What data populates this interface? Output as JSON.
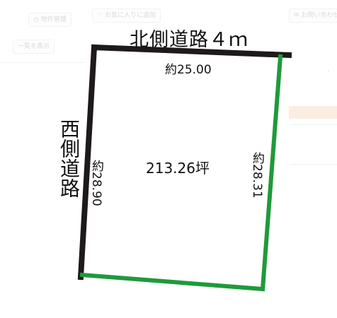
{
  "background": {
    "labels": [
      "お気に入りに追加",
      "お問い合わせ",
      "物件管理",
      "一覧を表示"
    ]
  },
  "plot": {
    "road_north": "北側道路４ｍ",
    "road_west": "西側道路",
    "edge_north_length": "約25.00",
    "edge_west_length": "約28.90",
    "edge_east_length": "約28.31",
    "area": "213.26坪",
    "colors": {
      "road_edge": "#1e1a1a",
      "neighbor_edge": "#1f9a3a"
    }
  }
}
